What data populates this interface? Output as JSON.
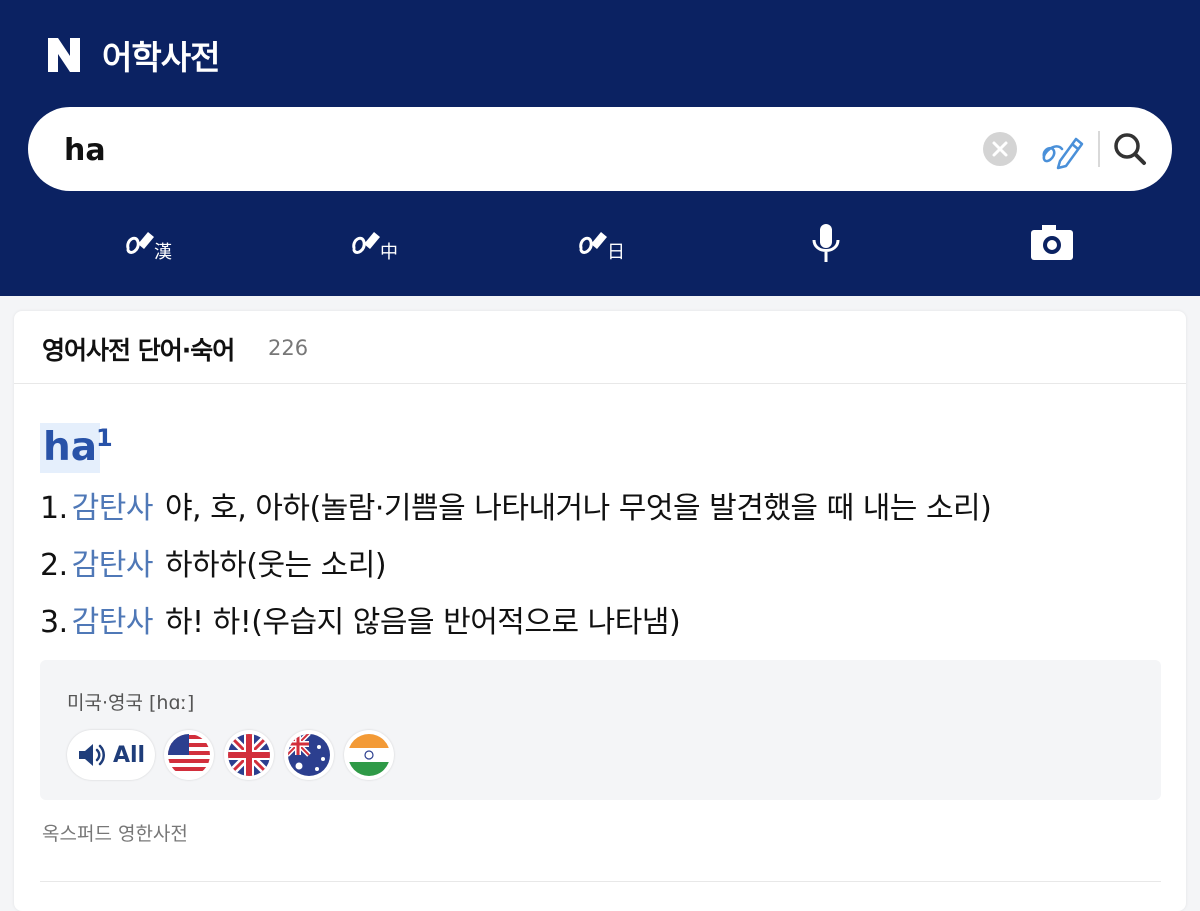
{
  "header": {
    "logo": "N",
    "title": "어학사전",
    "bg_color": "#0b2262"
  },
  "search": {
    "value": "ha",
    "clear_icon": "clear-icon",
    "handwrite_icon": "handwriting-icon",
    "search_icon": "search-icon"
  },
  "tools": [
    {
      "icon": "handwriting-hanja-icon",
      "glyph": "漢"
    },
    {
      "icon": "handwriting-chinese-icon",
      "glyph": "中"
    },
    {
      "icon": "handwriting-japanese-icon",
      "glyph": "日"
    },
    {
      "icon": "microphone-icon"
    },
    {
      "icon": "camera-icon"
    }
  ],
  "results": {
    "title": "영어사전 단어·숙어",
    "count": "226",
    "entry": {
      "word": "ha",
      "superscript": "1",
      "meanings": [
        {
          "num": "1.",
          "pos": "감탄사",
          "text": "야, 호, 아하(놀람·기쁨을 나타내거나 무엇을 발견했을 때 내는 소리)"
        },
        {
          "num": "2.",
          "pos": "감탄사",
          "text": "하하하(웃는 소리)"
        },
        {
          "num": "3.",
          "pos": "감탄사",
          "text": "하! 하!(우습지 않음을 반어적으로 나타냄)"
        }
      ],
      "pronunciation": {
        "label": "미국·영국 [hɑː]",
        "all_label": "All",
        "flags": [
          "us-flag-icon",
          "uk-flag-icon",
          "australia-flag-icon",
          "india-flag-icon"
        ]
      },
      "source": "옥스퍼드 영한사전"
    }
  },
  "colors": {
    "accent": "#2852a8",
    "pos": "#4f78b7"
  }
}
